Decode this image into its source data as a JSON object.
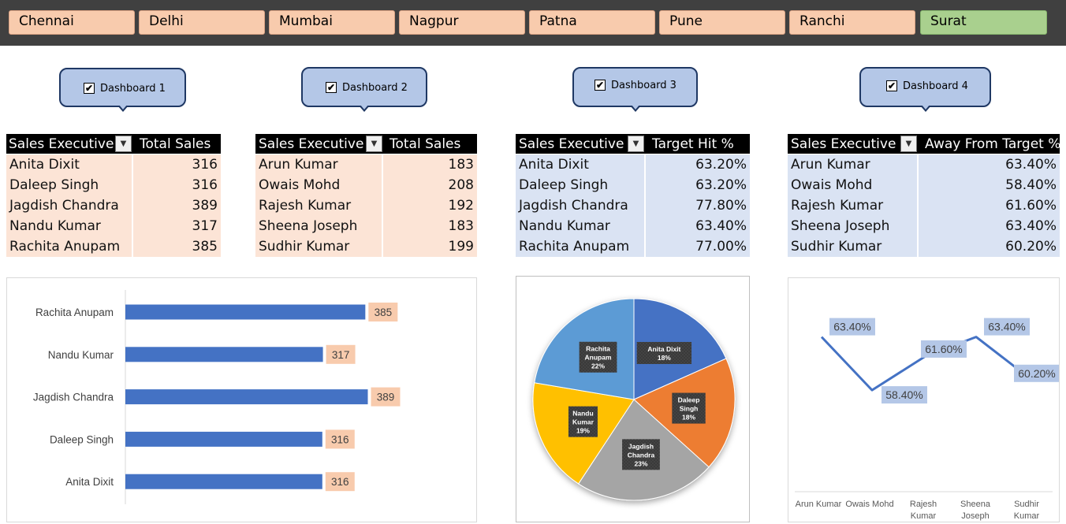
{
  "slicer": {
    "items": [
      "Chennai",
      "Delhi",
      "Mumbai",
      "Nagpur",
      "Patna",
      "Pune",
      "Ranchi",
      "Surat"
    ],
    "selected": "Surat"
  },
  "checkboxes": [
    {
      "label": "Dashboard 1",
      "checked": true
    },
    {
      "label": "Dashboard 2",
      "checked": true
    },
    {
      "label": "Dashboard 3",
      "checked": true
    },
    {
      "label": "Dashboard 4",
      "checked": true
    }
  ],
  "tables": [
    {
      "col1": "Sales Executive",
      "col2": "Total Sales",
      "rows": [
        [
          "Anita Dixit",
          "316"
        ],
        [
          "Daleep Singh",
          "316"
        ],
        [
          "Jagdish Chandra",
          "389"
        ],
        [
          "Nandu Kumar",
          "317"
        ],
        [
          "Rachita Anupam",
          "385"
        ]
      ]
    },
    {
      "col1": "Sales Executive",
      "col2": "Total Sales",
      "rows": [
        [
          "Arun Kumar",
          "183"
        ],
        [
          "Owais Mohd",
          "208"
        ],
        [
          "Rajesh Kumar",
          "192"
        ],
        [
          "Sheena Joseph",
          "183"
        ],
        [
          "Sudhir Kumar",
          "199"
        ]
      ]
    },
    {
      "col1": "Sales Executive",
      "col2": "Target Hit %",
      "rows": [
        [
          "Anita Dixit",
          "63.20%"
        ],
        [
          "Daleep Singh",
          "63.20%"
        ],
        [
          "Jagdish Chandra",
          "77.80%"
        ],
        [
          "Nandu Kumar",
          "63.40%"
        ],
        [
          "Rachita Anupam",
          "77.00%"
        ]
      ]
    },
    {
      "col1": "Sales Executive",
      "col2": "Away From Target %",
      "rows": [
        [
          "Arun Kumar",
          "63.40%"
        ],
        [
          "Owais Mohd",
          "58.40%"
        ],
        [
          "Rajesh Kumar",
          "61.60%"
        ],
        [
          "Sheena Joseph",
          "63.40%"
        ],
        [
          "Sudhir Kumar",
          "60.20%"
        ]
      ]
    }
  ],
  "chart_data": [
    {
      "type": "bar",
      "orientation": "horizontal",
      "categories": [
        "Rachita Anupam",
        "Nandu Kumar",
        "Jagdish Chandra",
        "Daleep Singh",
        "Anita Dixit"
      ],
      "values": [
        385,
        317,
        389,
        316,
        316
      ],
      "data_labels": [
        "385",
        "317",
        "389",
        "316",
        "316"
      ],
      "xlim": [
        0,
        420
      ],
      "bar_color": "#4472c4",
      "label_bg": "#f8cbad"
    },
    {
      "type": "pie",
      "categories": [
        "Anita Dixit",
        "Daleep Singh",
        "Jagdish Chandra",
        "Nandu Kumar",
        "Rachita Anupam"
      ],
      "label_lines": [
        [
          "Anita Dixit",
          "18%"
        ],
        [
          "Daleep",
          "Singh",
          "18%"
        ],
        [
          "Jagdish",
          "Chandra",
          "23%"
        ],
        [
          "Nandu",
          "Kumar",
          "19%"
        ],
        [
          "Rachita",
          "Anupam",
          "22%"
        ]
      ],
      "values": [
        316,
        316,
        389,
        317,
        385
      ],
      "colors": [
        "#4472c4",
        "#ed7d31",
        "#a5a5a5",
        "#ffc000",
        "#5b9bd5"
      ]
    },
    {
      "type": "line",
      "categories": [
        "Arun Kumar",
        "Owais Mohd",
        "Rajesh Kumar",
        "Sheena Joseph",
        "Sudhir Kumar"
      ],
      "category_lines": [
        [
          "Arun Kumar"
        ],
        [
          "Owais Mohd"
        ],
        [
          "Rajesh",
          "Kumar"
        ],
        [
          "Sheena",
          "Joseph"
        ],
        [
          "Sudhir",
          "Kumar"
        ]
      ],
      "values": [
        63.4,
        58.4,
        61.6,
        63.4,
        60.2
      ],
      "data_labels": [
        "63.40%",
        "58.40%",
        "61.60%",
        "63.40%",
        "60.20%"
      ],
      "ylim": [
        55,
        65
      ],
      "line_color": "#4472c4",
      "label_bg": "#b4c7e7"
    }
  ]
}
